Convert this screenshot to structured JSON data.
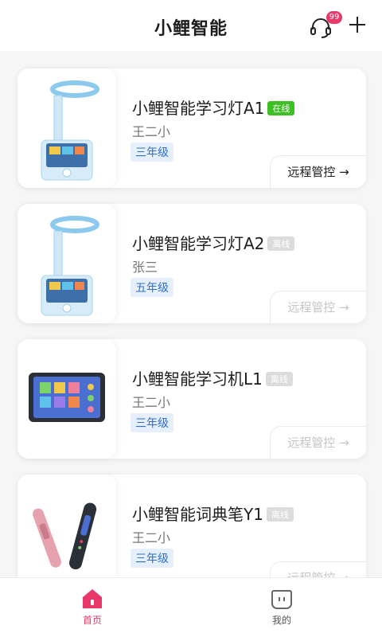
{
  "header": {
    "title": "小鲤智能",
    "support_badge": "99"
  },
  "devices": [
    {
      "name": "小鲤智能学习灯A1",
      "status": "在线",
      "user": "王二小",
      "grade": "三年级",
      "action": "远程管控 →"
    },
    {
      "name": "小鲤智能学习灯A2",
      "status": "离线",
      "user": "张三",
      "grade": "五年级",
      "action": "远程管控 →"
    },
    {
      "name": "小鲤智能学习机L1",
      "status": "离线",
      "user": "王二小",
      "grade": "三年级",
      "action": "远程管控 →"
    },
    {
      "name": "小鲤智能词典笔Y1",
      "status": "离线",
      "user": "王二小",
      "grade": "三年级",
      "action": "远程管控 →"
    }
  ],
  "tabbar": {
    "home": "首页",
    "mine": "我的"
  },
  "colors": {
    "accent": "#e8386a",
    "online": "#3fbf26",
    "grade_text": "#2f6fd6"
  }
}
